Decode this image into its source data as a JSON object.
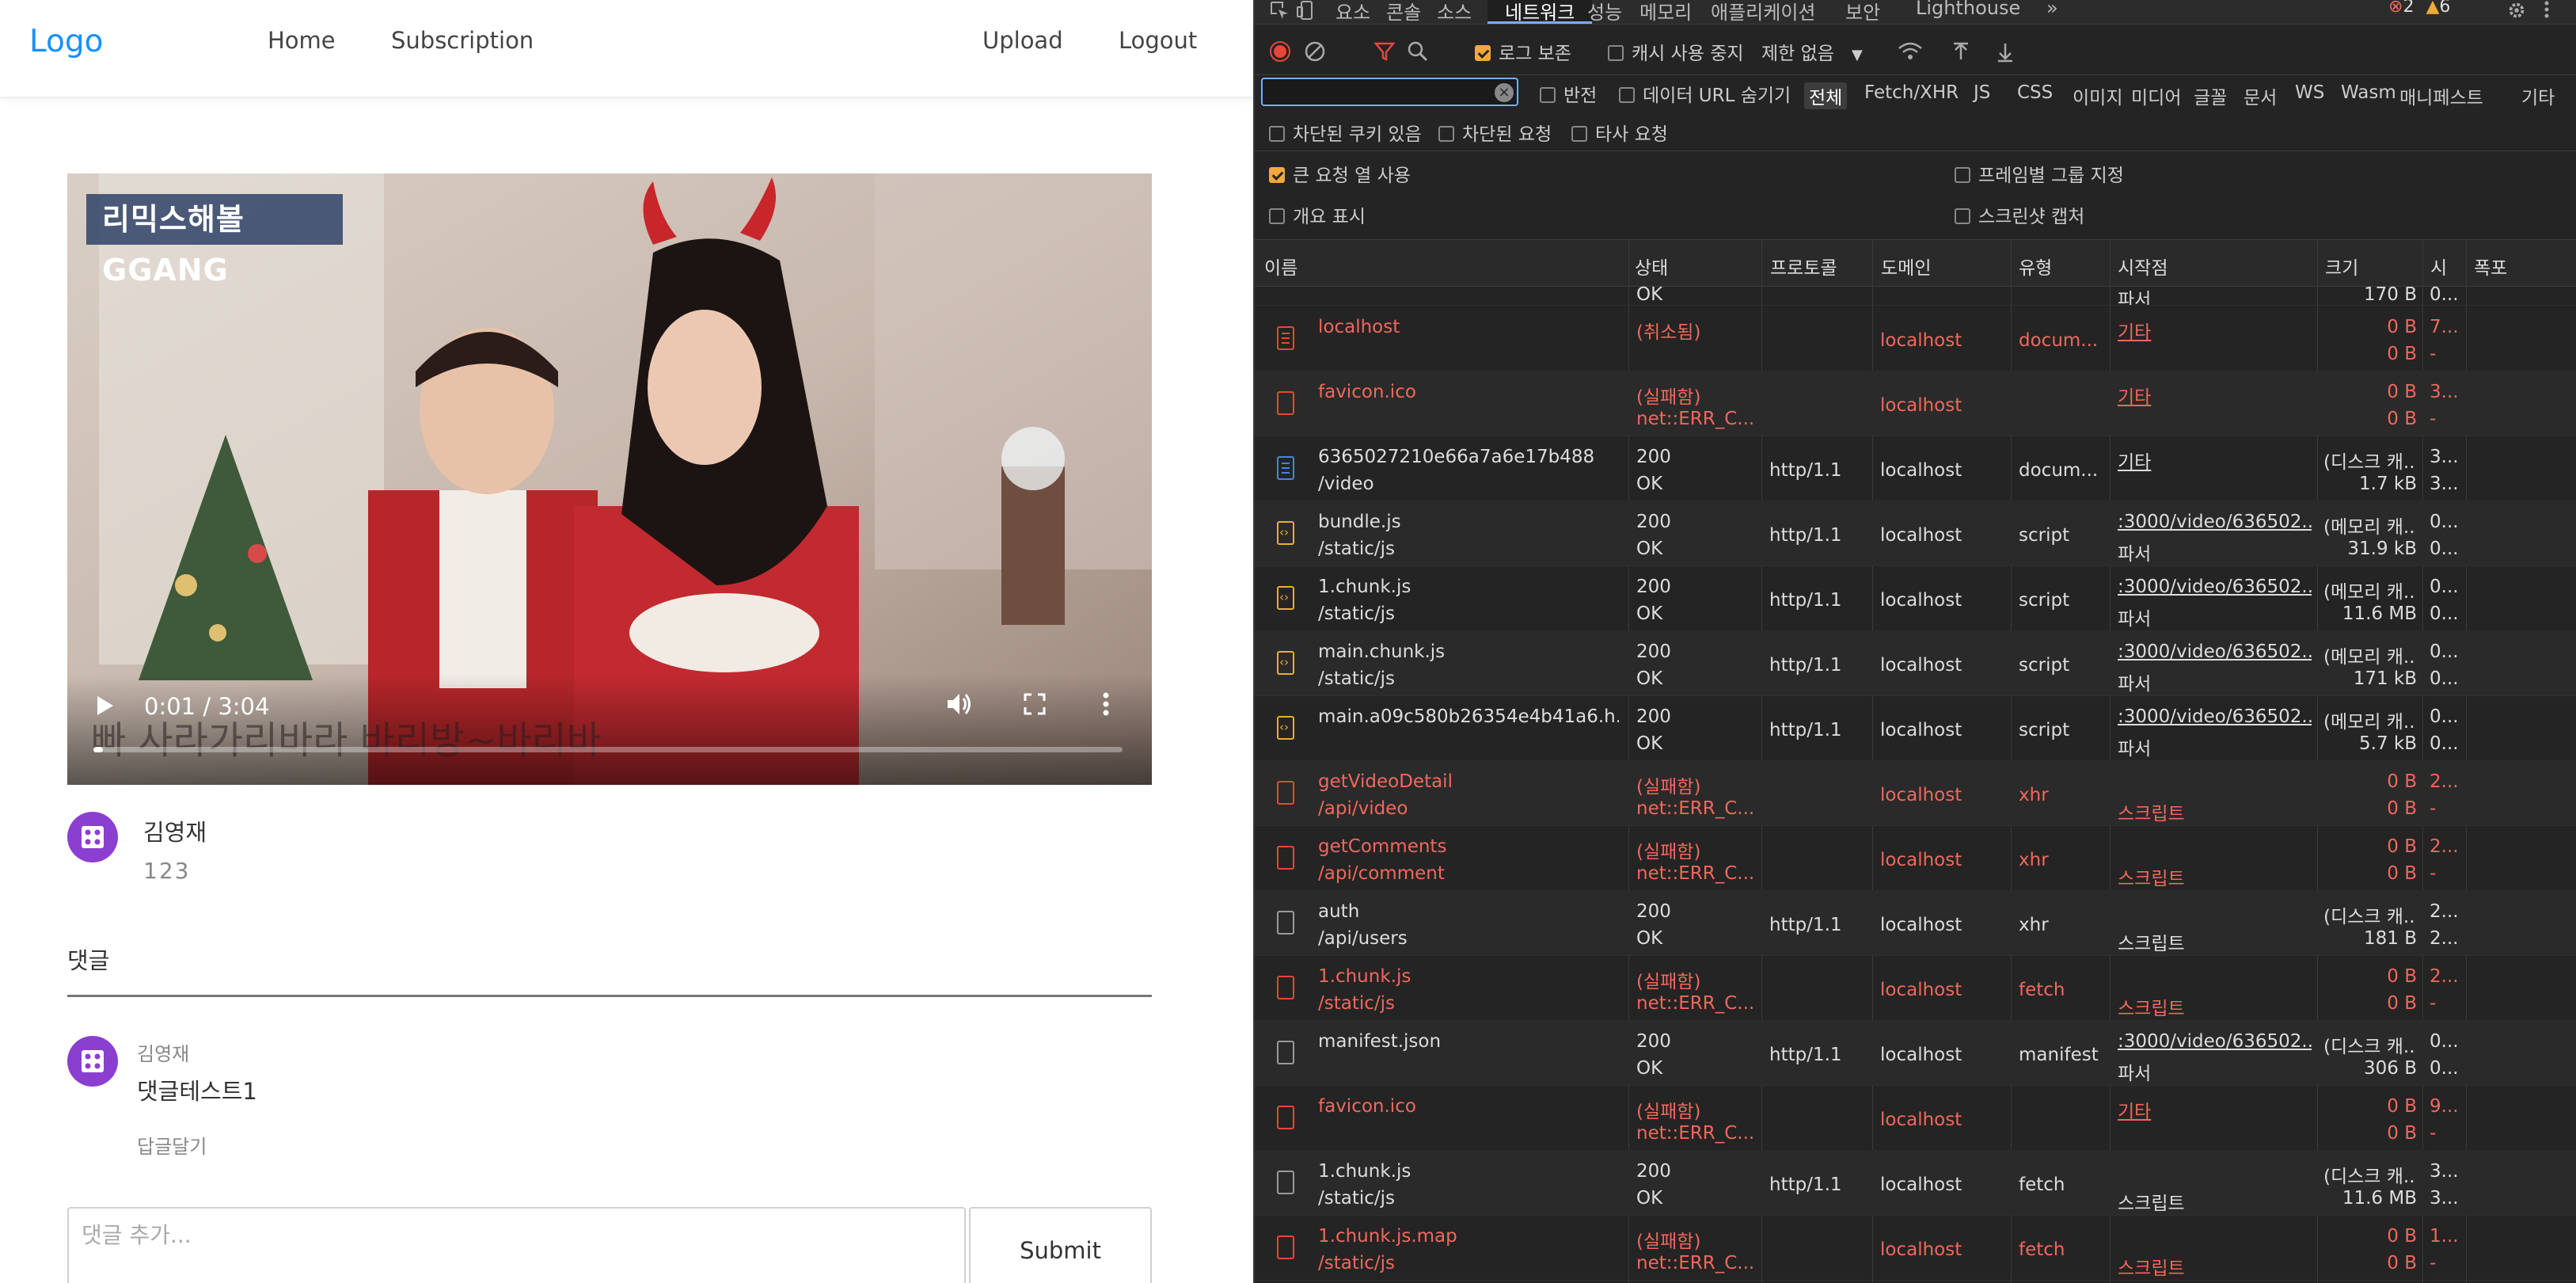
{
  "app": {
    "nav": {
      "logo": "Logo",
      "home": "Home",
      "subscription": "Subscription",
      "upload": "Upload",
      "logout": "Logout"
    },
    "video": {
      "badge": "리믹스해볼GGANG",
      "subtitle": "빠 사라가리바라 바리방~바리바",
      "time": "0:01 / 3:04",
      "progress": 0.009
    },
    "uploader": {
      "name": "김영재",
      "subtext": "123"
    },
    "comments": {
      "title": "댓글",
      "items": [
        {
          "author": "김영재",
          "text": "댓글테스트1",
          "reply_label": "답글달기"
        }
      ],
      "input_placeholder": "댓글 추가...",
      "submit_label": "Submit"
    }
  },
  "devtools": {
    "tabs": [
      "요소",
      "콘솔",
      "소스",
      "네트워크",
      "성능",
      "메모리",
      "애플리케이션",
      "보안",
      "Lighthouse",
      "»"
    ],
    "active_tab": "네트워크",
    "issues": {
      "errors": "2",
      "warnings": "6"
    },
    "toolbar": {
      "preserve_log": "로그 보존",
      "disable_cache": "캐시 사용 중지",
      "throttling": "제한 없음"
    },
    "filter": {
      "invert": "반전",
      "hide_data_urls": "데이터 URL 숨기기",
      "types": [
        "전체",
        "Fetch/XHR",
        "JS",
        "CSS",
        "이미지",
        "미디어",
        "글꼴",
        "문서",
        "WS",
        "Wasm",
        "매니페스트",
        "기타"
      ],
      "active_type": "전체",
      "blocked_cookies": "차단된 쿠키 있음",
      "blocked_requests": "차단된 요청",
      "third_party": "타사 요청"
    },
    "options": {
      "big_rows": "큰 요청 열 사용",
      "group_by_frame": "프레임별 그룹 지정",
      "overview": "개요 표시",
      "screenshots": "스크린샷 캡처"
    },
    "columns": [
      "이름",
      "상태",
      "프로토콜",
      "도메인",
      "유형",
      "시작점",
      "크기",
      "시",
      "폭포"
    ],
    "partial_row": {
      "status": "OK",
      "initiator": "파서",
      "size": "170 B",
      "time": "0..."
    },
    "rows": [
      {
        "name": "localhost",
        "path": "",
        "status1": "(취소됨)",
        "status2": "",
        "protocol": "",
        "domain": "localhost",
        "type": "docum...",
        "initiator1": "기타",
        "initiator2": "",
        "size1": "0 B",
        "size2": "0 B",
        "time1": "7...",
        "time2": "-",
        "icon": "document-icon",
        "failed": true
      },
      {
        "name": "favicon.ico",
        "path": "",
        "status1": "(실패함)",
        "status2": "net::ERR_C...",
        "protocol": "",
        "domain": "localhost",
        "type": "",
        "initiator1": "기타",
        "initiator2": "",
        "size1": "0 B",
        "size2": "0 B",
        "time1": "3...",
        "time2": "-",
        "icon": "file-icon",
        "failed": true
      },
      {
        "name": "6365027210e66a7a6e17b488",
        "path": "/video",
        "status1": "200",
        "status2": "OK",
        "protocol": "http/1.1",
        "domain": "localhost",
        "type": "docum...",
        "initiator1": "기타",
        "initiator2": "",
        "size1": "(디스크 캐...",
        "size2": "1.7 kB",
        "time1": "3...",
        "time2": "3...",
        "icon": "document-icon",
        "failed": false
      },
      {
        "name": "bundle.js",
        "path": "/static/js",
        "status1": "200",
        "status2": "OK",
        "protocol": "http/1.1",
        "domain": "localhost",
        "type": "script",
        "initiator1": ":3000/video/636502...",
        "initiator2": "파서",
        "size1": "(메모리 캐...",
        "size2": "31.9 kB",
        "time1": "0...",
        "time2": "0...",
        "icon": "script-icon",
        "failed": false
      },
      {
        "name": "1.chunk.js",
        "path": "/static/js",
        "status1": "200",
        "status2": "OK",
        "protocol": "http/1.1",
        "domain": "localhost",
        "type": "script",
        "initiator1": ":3000/video/636502...",
        "initiator2": "파서",
        "size1": "(메모리 캐...",
        "size2": "11.6 MB",
        "time1": "0...",
        "time2": "0...",
        "icon": "script-icon",
        "failed": false
      },
      {
        "name": "main.chunk.js",
        "path": "/static/js",
        "status1": "200",
        "status2": "OK",
        "protocol": "http/1.1",
        "domain": "localhost",
        "type": "script",
        "initiator1": ":3000/video/636502...",
        "initiator2": "파서",
        "size1": "(메모리 캐...",
        "size2": "171 kB",
        "time1": "0...",
        "time2": "0...",
        "icon": "script-icon",
        "failed": false
      },
      {
        "name": "main.a09c580b26354e4b41a6.h...",
        "path": "",
        "status1": "200",
        "status2": "OK",
        "protocol": "http/1.1",
        "domain": "localhost",
        "type": "script",
        "initiator1": ":3000/video/636502...",
        "initiator2": "파서",
        "size1": "(메모리 캐...",
        "size2": "5.7 kB",
        "time1": "0...",
        "time2": "0...",
        "icon": "script-icon",
        "failed": false
      },
      {
        "name": "getVideoDetail",
        "path": "/api/video",
        "status1": "(실패함)",
        "status2": "net::ERR_C...",
        "protocol": "",
        "domain": "localhost",
        "type": "xhr",
        "initiator1": "",
        "initiator2": "스크립트",
        "size1": "0 B",
        "size2": "0 B",
        "time1": "2...",
        "time2": "-",
        "icon": "file-icon",
        "failed": true
      },
      {
        "name": "getComments",
        "path": "/api/comment",
        "status1": "(실패함)",
        "status2": "net::ERR_C...",
        "protocol": "",
        "domain": "localhost",
        "type": "xhr",
        "initiator1": "",
        "initiator2": "스크립트",
        "size1": "0 B",
        "size2": "0 B",
        "time1": "2...",
        "time2": "-",
        "icon": "file-icon",
        "failed": true
      },
      {
        "name": "auth",
        "path": "/api/users",
        "status1": "200",
        "status2": "OK",
        "protocol": "http/1.1",
        "domain": "localhost",
        "type": "xhr",
        "initiator1": "",
        "initiator2": "스크립트",
        "size1": "(디스크 캐...",
        "size2": "181 B",
        "time1": "2...",
        "time2": "2...",
        "icon": "file-icon",
        "failed": false
      },
      {
        "name": "1.chunk.js",
        "path": "/static/js",
        "status1": "(실패함)",
        "status2": "net::ERR_C...",
        "protocol": "",
        "domain": "localhost",
        "type": "fetch",
        "initiator1": "",
        "initiator2": "스크립트",
        "size1": "0 B",
        "size2": "0 B",
        "time1": "2...",
        "time2": "-",
        "icon": "file-icon",
        "failed": true
      },
      {
        "name": "manifest.json",
        "path": "",
        "status1": "200",
        "status2": "OK",
        "protocol": "http/1.1",
        "domain": "localhost",
        "type": "manifest",
        "initiator1": ":3000/video/636502...",
        "initiator2": "파서",
        "size1": "(디스크 캐...",
        "size2": "306 B",
        "time1": "0...",
        "time2": "0...",
        "icon": "file-icon",
        "failed": false
      },
      {
        "name": "favicon.ico",
        "path": "",
        "status1": "(실패함)",
        "status2": "net::ERR_C...",
        "protocol": "",
        "domain": "localhost",
        "type": "",
        "initiator1": "기타",
        "initiator2": "",
        "size1": "0 B",
        "size2": "0 B",
        "time1": "9...",
        "time2": "-",
        "icon": "file-icon",
        "failed": true
      },
      {
        "name": "1.chunk.js",
        "path": "/static/js",
        "status1": "200",
        "status2": "OK",
        "protocol": "http/1.1",
        "domain": "localhost",
        "type": "fetch",
        "initiator1": "",
        "initiator2": "스크립트",
        "size1": "(디스크 캐...",
        "size2": "11.6 MB",
        "time1": "3...",
        "time2": "3...",
        "icon": "file-icon",
        "failed": false
      },
      {
        "name": "1.chunk.js.map",
        "path": "/static/js",
        "status1": "(실패함)",
        "status2": "net::ERR_C...",
        "protocol": "",
        "domain": "localhost",
        "type": "fetch",
        "initiator1": "",
        "initiator2": "스크립트",
        "size1": "0 B",
        "size2": "0 B",
        "time1": "1...",
        "time2": "-",
        "icon": "file-icon",
        "failed": true
      }
    ]
  }
}
